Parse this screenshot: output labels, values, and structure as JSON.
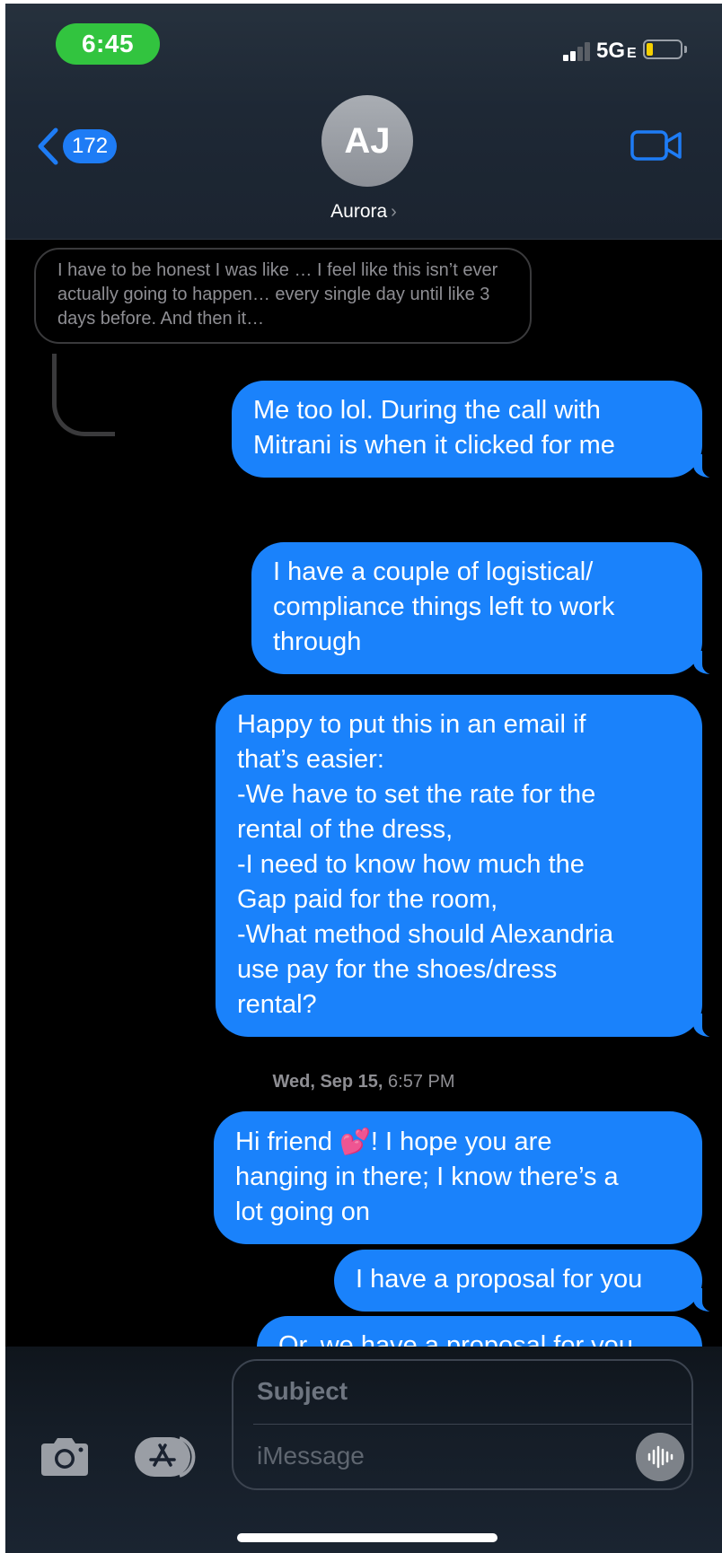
{
  "status_bar": {
    "time": "6:45",
    "network": "5G",
    "network_suffix": "E",
    "battery_color": "#f5d000"
  },
  "header": {
    "back_count": "172",
    "avatar_initials": "AJ",
    "contact_name": "Aurora",
    "contact_chevron": "›",
    "video_icon": "video-camera-icon",
    "accent_color": "#1a82fb"
  },
  "thread": {
    "reply_quote": "I have to be honest I was like … I feel like this isn’t ever actually going to happen… every single day until like 3 days before. And then it…",
    "messages": [
      {
        "text": "Me too lol. During the call with\nMitrani is when it clicked for me"
      },
      {
        "text": "I have a couple of logistical/\ncompliance things left to work\nthrough"
      },
      {
        "text": "Happy to put this in an email if\nthat’s easier:\n-We have to set the rate for the\nrental of the dress,\n-I need to know how much the\nGap paid for the room,\n-What method should Alexandria\nuse pay for the shoes/dress\nrental?"
      },
      {
        "text_before": "Hi friend ",
        "emoji": "💕",
        "text_after": "! I hope you are\nhanging in there; I know there’s a\nlot going on"
      },
      {
        "text": "I have a proposal for you"
      },
      {
        "text": "Or, we have a proposal for you"
      }
    ],
    "timestamp_day": "Wed, Sep 15,",
    "timestamp_time": "6:57 PM"
  },
  "compose": {
    "subject_placeholder": "Subject",
    "message_placeholder": "iMessage",
    "camera_icon": "camera-icon",
    "appstore_icon": "app-store-icon",
    "audio_icon": "audio-waveform-icon"
  }
}
